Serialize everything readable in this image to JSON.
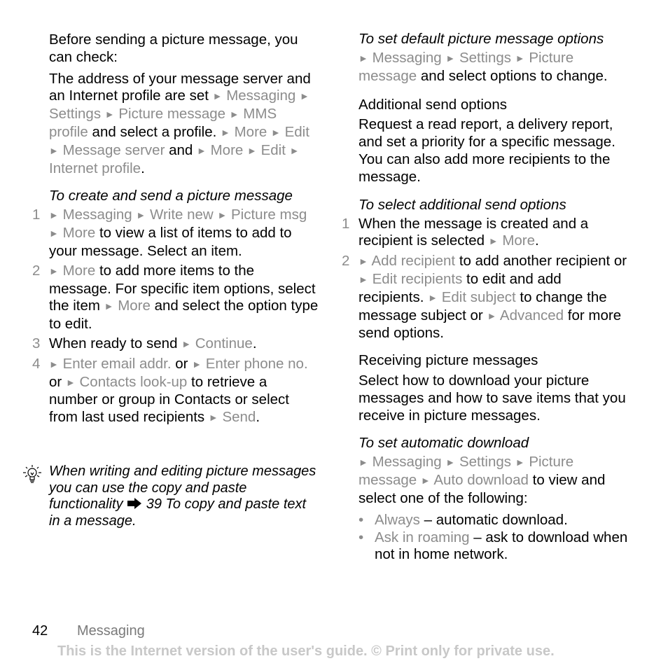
{
  "left_column": {
    "intro": "Before sending a picture message, you can check:",
    "check": {
      "text1": "The address of your message server and an Internet profile are set",
      "path1": [
        "Messaging",
        "Settings",
        "Picture message",
        "MMS profile"
      ],
      "text2": "and select a profile.",
      "path2": [
        "More",
        "Edit",
        "Message server"
      ],
      "text3": "and",
      "path3": [
        "More",
        "Edit",
        "Internet profile"
      ],
      "text4": "."
    },
    "create_heading": "To create and send a picture message",
    "steps": [
      {
        "num": "1",
        "path": [
          "Messaging",
          "Write new",
          "Picture msg",
          "More"
        ],
        "text": "to view a list of items to add to your message. Select an item."
      },
      {
        "num": "2",
        "path": [
          "More"
        ],
        "text": "to add more items to the message. For specific item options, select the item",
        "path2": [
          "More"
        ],
        "text2": "and select the option type to edit."
      },
      {
        "num": "3",
        "text": "When ready to send",
        "path": [
          "Continue"
        ],
        "text2": "."
      },
      {
        "num": "4",
        "path": [
          "Enter email addr."
        ],
        "text": "or",
        "path2": [
          "Enter phone no."
        ],
        "text2": "or",
        "path3": [
          "Contacts look-up"
        ],
        "text3": "to retrieve a number or group in Contacts or select from last used recipients",
        "path4": [
          "Send"
        ],
        "text4": "."
      }
    ],
    "tip": {
      "icon": "lightbulb-icon",
      "text1": "When writing and editing picture messages you can use the copy and paste functionality",
      "ref_icon": "arrow-right-icon",
      "text2": "39 To copy and paste text in a message",
      "text3": "."
    }
  },
  "right_column": {
    "default_heading": "To set default picture message options",
    "default_path": [
      "Messaging",
      "Settings",
      "Picture message"
    ],
    "default_text": "and select options to change.",
    "additional_heading": "Additional send options",
    "additional_body": "Request a read report, a delivery report, and set a priority for a specific message. You can also add more recipients to the message.",
    "select_heading": "To select additional send options",
    "steps": [
      {
        "num": "1",
        "text": "When the message is created and a recipient is selected",
        "path": [
          "More"
        ],
        "text2": "."
      },
      {
        "num": "2",
        "path": [
          "Add recipient"
        ],
        "text": "to add another recipient or",
        "path2": [
          "Edit recipients"
        ],
        "text2": "to edit and add recipients.",
        "path3": [
          "Edit subject"
        ],
        "text3": "to change the message subject or",
        "path4": [
          "Advanced"
        ],
        "text4": "for more send options."
      }
    ],
    "receiving_heading": "Receiving picture messages",
    "receiving_body": "Select how to download your picture messages and how to save items that you receive in picture messages.",
    "auto_heading": "To set automatic download",
    "auto_path": [
      "Messaging",
      "Settings",
      "Picture message",
      "Auto download"
    ],
    "auto_text": "to view and select one of the following:",
    "options": [
      {
        "label": "Always",
        "desc": "– automatic download."
      },
      {
        "label": "Ask in roaming",
        "desc": "– ask to download when not in home network."
      }
    ]
  },
  "footer": {
    "page_number": "42",
    "section": "Messaging",
    "note": "This is the Internet version of the user's guide. © Print only for private use."
  },
  "colors": {
    "nav_gray": "#8c8c8c",
    "footer_note": "#c8c8c8"
  },
  "nav_marker": "►"
}
